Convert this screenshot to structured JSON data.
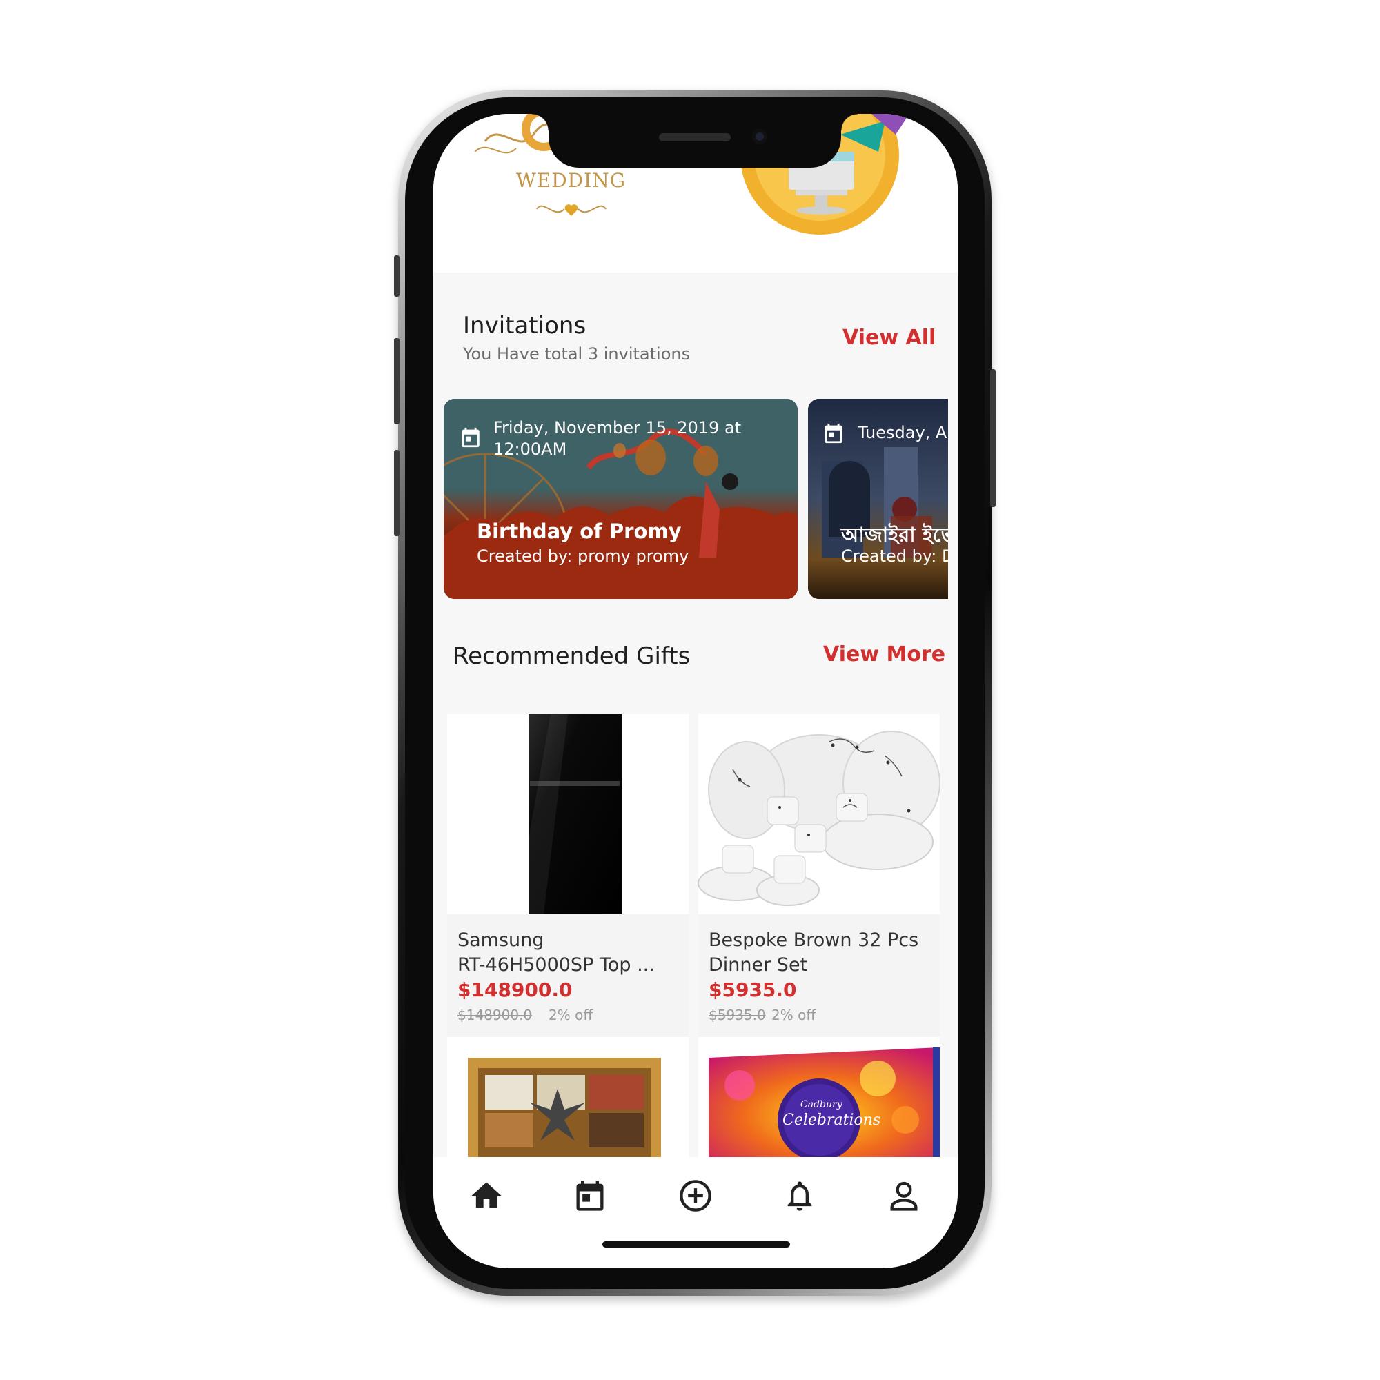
{
  "banner": {
    "wedding_label": "WEDDING"
  },
  "invitations": {
    "title": "Invitations",
    "subtitle": "You Have total 3 invitations",
    "view_all": "View All",
    "cards": [
      {
        "date_line1": "Friday, November 15, 2019 at",
        "date_line2": "12:00AM",
        "title": "Birthday of Promy",
        "creator": "Created by: promy promy"
      },
      {
        "date_line1": "Tuesday, A",
        "title": "আজাইরা ইভে",
        "creator": "Created by: D"
      }
    ]
  },
  "gifts": {
    "title": "Recommended Gifts",
    "view_more": "View More",
    "items": [
      {
        "name_line1": "Samsung",
        "name_line2": "RT-46H5000SP Top ...",
        "price": "$148900.0",
        "old_price": "$148900.0",
        "discount": "2% off"
      },
      {
        "name_line1": "Bespoke Brown 32 Pcs",
        "name_line2": "Dinner Set",
        "price": "$5935.0",
        "old_price": "$5935.0",
        "discount": "2% off"
      },
      {
        "name_line1": "",
        "name_line2": ""
      },
      {
        "name_line1": "",
        "name_line2": "",
        "brand_text": "Cadbury",
        "product_text": "Celebrations"
      }
    ]
  },
  "bottom_nav": {
    "items": [
      {
        "icon": "home-icon"
      },
      {
        "icon": "calendar-icon"
      },
      {
        "icon": "add-circle-icon"
      },
      {
        "icon": "bell-icon"
      },
      {
        "icon": "profile-icon"
      }
    ]
  },
  "colors": {
    "accent_red": "#d32f2f",
    "wedding_gold": "#c49447",
    "card1_bg": "#3b5f63",
    "card2_bg": "#233046"
  }
}
